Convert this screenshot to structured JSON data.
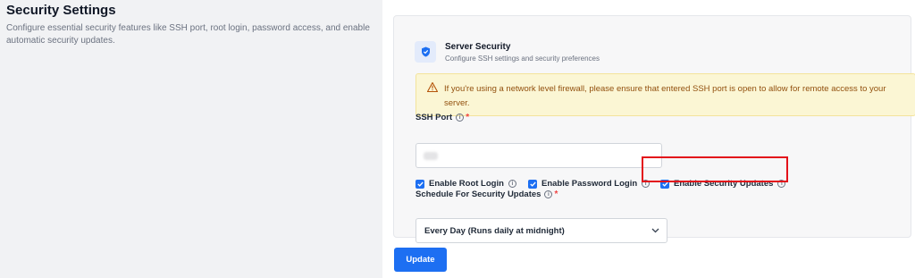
{
  "page": {
    "title": "Security Settings",
    "description": "Configure essential security features like SSH port, root login, password access, and enable automatic security updates."
  },
  "card": {
    "title": "Server Security",
    "subtitle": "Configure SSH settings and security preferences",
    "icon": "shield-icon"
  },
  "alert": {
    "text": "If you're using a network level firewall, please ensure that entered SSH port is open to allow for remote access to your server.",
    "icon": "warning-icon"
  },
  "ssh_port": {
    "label": "SSH Port",
    "required_mark": "*",
    "value": ""
  },
  "checkboxes": [
    {
      "label": "Enable Root Login",
      "checked": true
    },
    {
      "label": "Enable Password Login",
      "checked": true
    },
    {
      "label": "Enable Security Updates",
      "checked": true,
      "highlighted": true
    }
  ],
  "schedule": {
    "label": "Schedule For Security Updates",
    "required_mark": "*",
    "selected": "Every Day (Runs daily at midnight)"
  },
  "update_button": {
    "label": "Update"
  },
  "colors": {
    "accent": "#1d6ff2",
    "alert_bg": "#fbf6d4",
    "alert_text": "#92500e",
    "highlight": "#e3111a",
    "required": "#ef4444"
  }
}
